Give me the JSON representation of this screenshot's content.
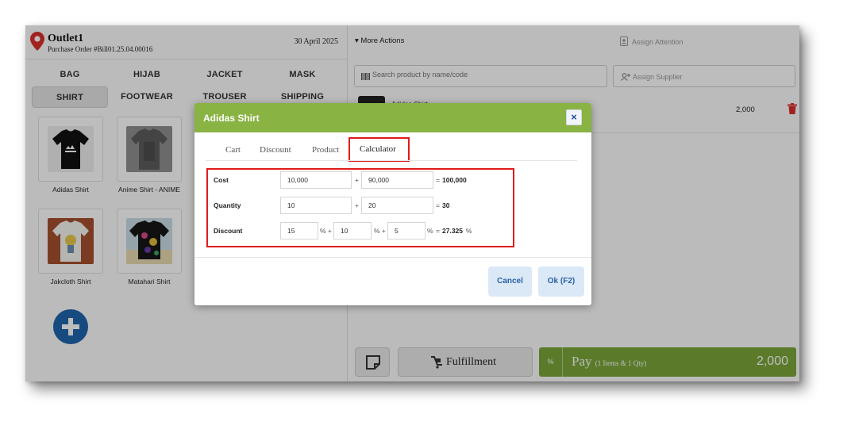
{
  "outlet": {
    "name": "Outlet1",
    "order": "Purchase Order #Bill01.25.04.00016",
    "date": "30 April 2025"
  },
  "categories": [
    {
      "label": "BAG"
    },
    {
      "label": "HIJAB"
    },
    {
      "label": "JACKET"
    },
    {
      "label": "MASK"
    },
    {
      "label": "SHIRT",
      "active": true
    },
    {
      "label": "FOOTWEAR"
    },
    {
      "label": "TROUSER"
    },
    {
      "label": "SHIPPING"
    }
  ],
  "products": [
    {
      "label": "Adidas Shirt"
    },
    {
      "label": "Anime Shirt - ANIME"
    },
    {
      "label": "Jakcloth Shirt"
    },
    {
      "label": "Matahari Shirt"
    }
  ],
  "toolbar": {
    "more_actions": "More Actions",
    "assign_attention": "Assign Attention",
    "search_placeholder": "Search product by name/code",
    "assign_supplier": "Assign Supplier"
  },
  "cart": {
    "item_name": "Adidas Shirt",
    "item_price": "2,000"
  },
  "footer": {
    "fulfillment": "Fulfillment",
    "pay_percent": "%",
    "pay": "Pay",
    "pay_sub": "(1 Items & 1 Qty)",
    "pay_amount": "2,000"
  },
  "modal": {
    "title": "Adidas Shirt",
    "close": "×",
    "tabs": [
      "Cart",
      "Discount",
      "Product",
      "Calculator"
    ],
    "active_tab": "Calculator",
    "calculator": {
      "cost": {
        "label": "Cost",
        "a": "10,000",
        "op": "+",
        "b": "90,000",
        "eq": "=",
        "result": "100,000"
      },
      "quantity": {
        "label": "Quantity",
        "a": "10",
        "op": "+",
        "b": "20",
        "eq": "=",
        "result": "30"
      },
      "discount": {
        "label": "Discount",
        "a": "15",
        "pct1": "% +",
        "b": "10",
        "pct2": "% +",
        "c": "5",
        "pct3": "%",
        "eq": "=",
        "result": "27.325",
        "unit": "%"
      }
    },
    "cancel": "Cancel",
    "ok": "Ok (F2)"
  },
  "colors": {
    "accent_green": "#89b342",
    "pay_green": "#7ba63a",
    "highlight_red": "#e01b1b",
    "add_button_blue": "#1f66ad",
    "trash_red": "#d9302c"
  },
  "icons": [
    "location-pin-icon",
    "caret-down-icon",
    "id-badge-icon",
    "barcode-icon",
    "add-user-icon",
    "trash-icon",
    "plus-icon",
    "note-icon",
    "fulfillment-icon",
    "close-icon"
  ]
}
